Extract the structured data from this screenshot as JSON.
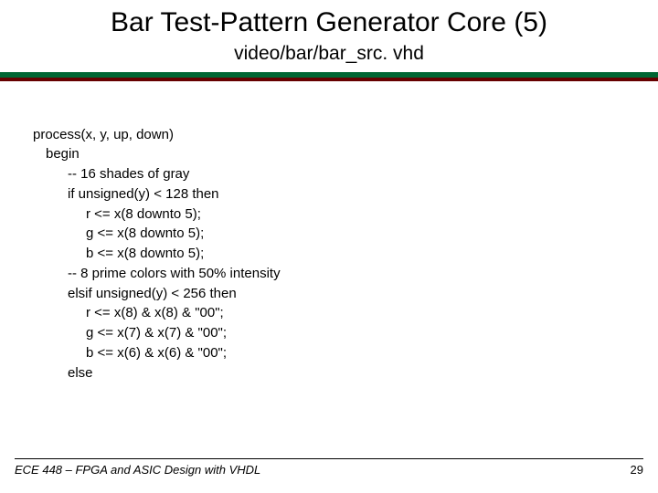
{
  "title": "Bar Test-Pattern Generator Core (5)",
  "subtitle": "video/bar/bar_src. vhd",
  "code": {
    "l1": "process(x, y, up, down)",
    "l2": "begin",
    "l3": "-- 16 shades of gray",
    "l4": "if unsigned(y) < 128 then",
    "l5": "r <=  x(8 downto 5);",
    "l6": "g <= x(8 downto 5);",
    "l7": "b <= x(8 downto 5);",
    "l8": "-- 8 prime colors with 50% intensity",
    "l9": "elsif unsigned(y) < 256 then",
    "l10": "r <= x(8) & x(8) & \"00\";",
    "l11": "g <= x(7) & x(7) & \"00\";",
    "l12": "b <= x(6) & x(6) & \"00\";",
    "l13": "else"
  },
  "footer": {
    "course": "ECE 448 – FPGA and ASIC Design with VHDL",
    "page": "29"
  }
}
